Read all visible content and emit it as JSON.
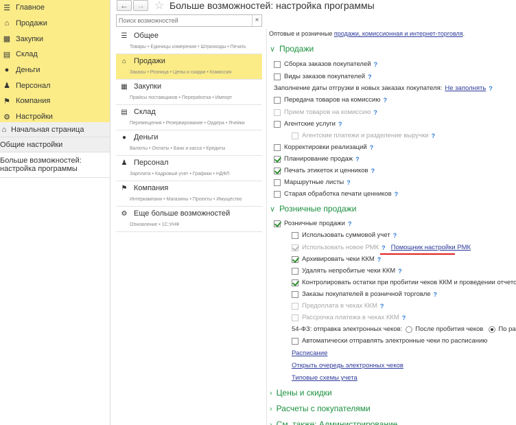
{
  "nav": {
    "main_items": [
      {
        "label": "Главное",
        "icon": "menu-lines-icon"
      },
      {
        "label": "Продажи",
        "icon": "shop-icon"
      },
      {
        "label": "Закупки",
        "icon": "cart-icon"
      },
      {
        "label": "Склад",
        "icon": "warehouse-icon"
      },
      {
        "label": "Деньги",
        "icon": "coin-icon"
      },
      {
        "label": "Персонал",
        "icon": "people-icon"
      },
      {
        "label": "Компания",
        "icon": "flag-icon"
      },
      {
        "label": "Настройки",
        "icon": "gear-icon"
      }
    ],
    "home": "Начальная страница",
    "general": "Общие настройки",
    "current": "Больше возможностей: настройка программы"
  },
  "header": {
    "back": "←",
    "forward": "→",
    "star": "☆",
    "title": "Больше возможностей: настройка программы"
  },
  "search": {
    "placeholder": "Поиск возможностей",
    "clear": "×"
  },
  "sections": [
    {
      "title": "Общее",
      "desc": "Товары • Единицы измерения • Штрихкоды • Печать",
      "icon": "list-icon",
      "active": false
    },
    {
      "title": "Продажи",
      "desc": "Заказы • Розница • Цены и скидки • Комиссия",
      "icon": "shop-icon",
      "active": true
    },
    {
      "title": "Закупки",
      "desc": "Прайсы поставщиков • Переработка • Импорт",
      "icon": "cart-icon",
      "active": false
    },
    {
      "title": "Склад",
      "desc": "Перемещения • Резервирование • Ордера • Ячейки",
      "icon": "warehouse-icon",
      "active": false
    },
    {
      "title": "Деньги",
      "desc": "Валюты • Оплаты • Банк и касса • Кредиты",
      "icon": "coin-icon",
      "active": false
    },
    {
      "title": "Персонал",
      "desc": "Зарплата • Кадровый учет • Графики • НДФЛ",
      "icon": "people-icon",
      "active": false
    },
    {
      "title": "Компания",
      "desc": "Интеркампани • Магазины • Проекты • Имущество",
      "icon": "flag-icon",
      "active": false
    },
    {
      "title": "Еще больше возможностей",
      "desc": "Обновление • 1С:УНФ",
      "icon": "gear-icon",
      "active": false
    }
  ],
  "content": {
    "intro_text": "Оптовые и розничные",
    "intro_link": "продажи, комиссионная и интернет-торговля",
    "intro_end": ".",
    "sales_group": "Продажи",
    "sales_options": [
      {
        "label": "Сборка заказов покупателей",
        "checked": false,
        "disabled": false
      },
      {
        "label": "Виды заказов покупателей",
        "checked": false,
        "disabled": false
      }
    ],
    "shipping_date_label": "Заполнение даты отгрузки в новых заказах покупателя:",
    "shipping_date_value": "Не заполнять",
    "sales_options2": [
      {
        "label": "Передача товаров на комиссию",
        "checked": false,
        "disabled": false
      },
      {
        "label": "Прием товаров на комиссию",
        "checked": false,
        "disabled": true
      },
      {
        "label": "Агентские услуги",
        "checked": false,
        "disabled": false
      }
    ],
    "agent_sub": {
      "label": "Агентские платежи и разделение выручки",
      "checked": false,
      "disabled": true
    },
    "sales_options3": [
      {
        "label": "Корректировки реализаций",
        "checked": false,
        "disabled": false
      },
      {
        "label": "Планирование продаж",
        "checked": true,
        "disabled": false
      },
      {
        "label": "Печать этикеток и ценников",
        "checked": true,
        "disabled": false
      },
      {
        "label": "Маршрутные листы",
        "checked": false,
        "disabled": false
      },
      {
        "label": "Старая обработка печати ценников",
        "checked": false,
        "disabled": false
      }
    ],
    "retail_group": "Розничные продажи",
    "retail_main": {
      "label": "Розничные продажи",
      "checked": true
    },
    "retail_options": [
      {
        "label": "Использовать суммовой учет",
        "checked": false,
        "disabled": false
      },
      {
        "label": "Использовать новое РМК",
        "checked": true,
        "disabled": true
      },
      {
        "label": "Архивировать чеки ККМ",
        "checked": true,
        "disabled": false
      },
      {
        "label": "Удалять непробитые чеки ККМ",
        "checked": false,
        "disabled": false
      },
      {
        "label": "Контролировать остатки при пробитии чеков ККМ и проведении отчетов",
        "checked": true,
        "disabled": false
      },
      {
        "label": "Заказы покупателей в розничной торговле",
        "checked": false,
        "disabled": false
      },
      {
        "label": "Предоплата в чеках ККМ",
        "checked": false,
        "disabled": true
      },
      {
        "label": "Рассрочка платежа в чеках ККМ",
        "checked": false,
        "disabled": true
      }
    ],
    "rmk_helper_link": "Помощник настройки РМК",
    "fz54_label": "54-ФЗ: отправка электронных чеков:",
    "fz54_opt1": "После пробития чеков",
    "fz54_opt2": "По расписанию",
    "auto_send": {
      "label": "Автоматически отправлять электронные чеки по расписанию",
      "checked": false
    },
    "schedule_link": "Расписание",
    "queue_link": "Открыть очередь электронных чеков",
    "templates_link": "Типовые схемы учета",
    "group_prices": "Цены и скидки",
    "group_settlements": "Расчеты с покупателями",
    "group_admin": "См. также: Администрирование"
  },
  "colors": {
    "accent_yellow": "#fbec88",
    "group_green": "#1b8f3e",
    "link_blue": "#2e3a9b",
    "highlight_red": "#e0201f"
  }
}
